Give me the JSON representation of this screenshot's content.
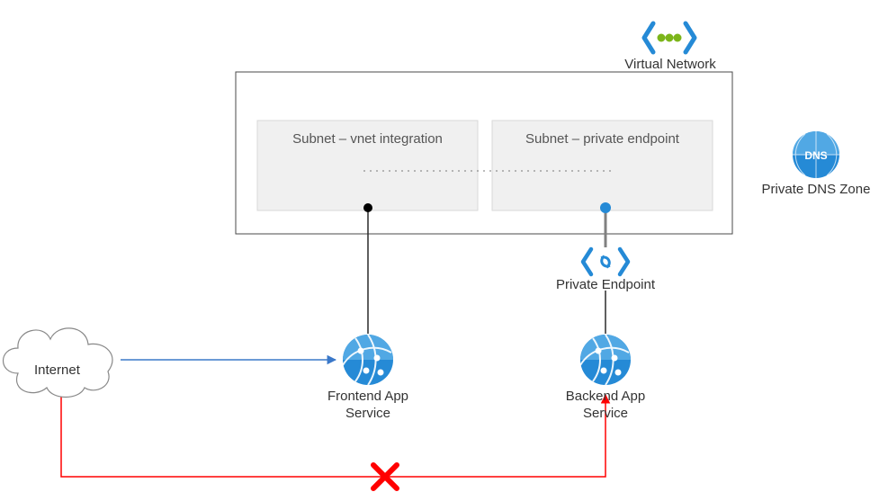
{
  "vnet": {
    "label": "Virtual Network",
    "subnet1": "Subnet – vnet integration",
    "subnet2": "Subnet – private endpoint"
  },
  "internet": {
    "label": "Internet"
  },
  "frontend": {
    "label": "Frontend App\nService"
  },
  "backend": {
    "label": "Backend App\nService"
  },
  "private_endpoint": {
    "label": "Private Endpoint"
  },
  "dns_zone": {
    "label": "Private DNS Zone",
    "badge": "DNS"
  },
  "colors": {
    "azure_blue": "#258ad6",
    "dark_azure": "#005ba1",
    "accent_green": "#7cb51a",
    "red": "#ff0000",
    "arrow_blue": "#3a78c9",
    "box_fill": "#f0f0f0",
    "box_stroke": "#d9d9d9",
    "vnet_stroke": "#4a4a4a",
    "grey_line": "#808080"
  },
  "chart_data": {
    "type": "diagram",
    "title": "",
    "nodes": [
      {
        "id": "internet",
        "label": "Internet",
        "kind": "cloud"
      },
      {
        "id": "frontend",
        "label": "Frontend App Service",
        "kind": "app-service"
      },
      {
        "id": "backend",
        "label": "Backend App Service",
        "kind": "app-service"
      },
      {
        "id": "vnet",
        "label": "Virtual Network",
        "kind": "virtual-network"
      },
      {
        "id": "subnet-integ",
        "label": "Subnet – vnet integration",
        "parent": "vnet",
        "kind": "subnet"
      },
      {
        "id": "subnet-pe",
        "label": "Subnet – private endpoint",
        "parent": "vnet",
        "kind": "subnet"
      },
      {
        "id": "private-endpoint",
        "label": "Private Endpoint",
        "kind": "private-endpoint"
      },
      {
        "id": "dns-zone",
        "label": "Private DNS Zone",
        "kind": "private-dns-zone"
      }
    ],
    "edges": [
      {
        "from": "internet",
        "to": "frontend",
        "style": "allowed-arrow"
      },
      {
        "from": "internet",
        "to": "backend",
        "style": "blocked-arrow"
      },
      {
        "from": "frontend",
        "to": "subnet-integ",
        "style": "solid-line"
      },
      {
        "from": "subnet-integ",
        "to": "subnet-pe",
        "style": "dotted-line"
      },
      {
        "from": "subnet-pe",
        "to": "private-endpoint",
        "style": "solid-line"
      },
      {
        "from": "private-endpoint",
        "to": "backend",
        "style": "solid-line"
      }
    ]
  }
}
